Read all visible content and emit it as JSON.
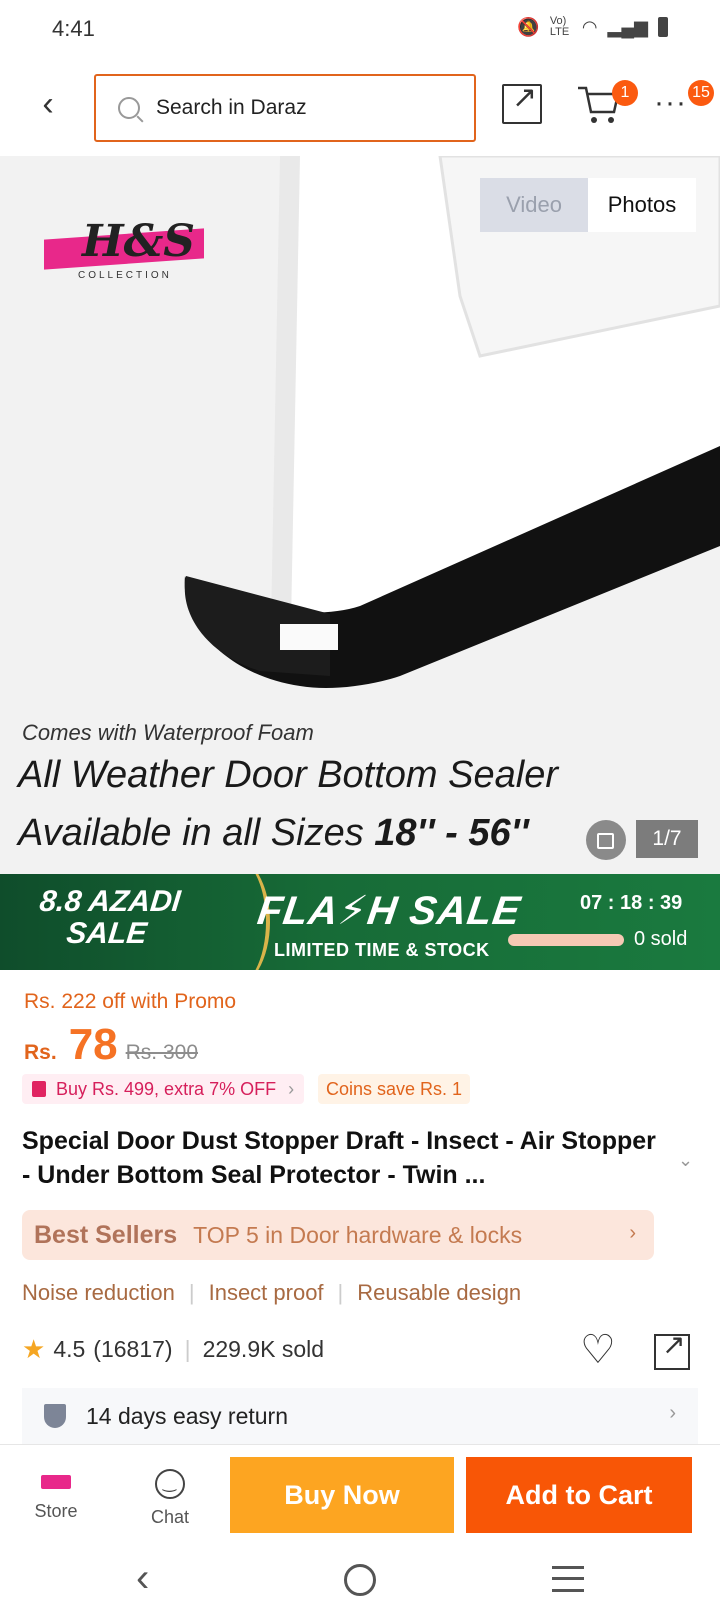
{
  "status": {
    "time": "4:41",
    "icons": [
      "mute-icon",
      "volte-icon",
      "wifi-icon",
      "signal-icon",
      "battery-icon"
    ],
    "volte_label": "Vo) LTE"
  },
  "header": {
    "search_placeholder": "Search in Daraz",
    "cart_count": "1",
    "more_count": "15"
  },
  "hero": {
    "tab_video": "Video",
    "tab_photos": "Photos",
    "brand": "H&S",
    "brand_sub": "COLLECTION",
    "caption_small": "Comes with Waterproof Foam",
    "caption_main": "All Weather Door Bottom Sealer",
    "caption_sizes": "Available in all Sizes ",
    "caption_sizes_bold": "18'' - 56''",
    "counter": "1/7"
  },
  "flash": {
    "azadi_line1": "8.8 AZADI",
    "azadi_line2": "SALE",
    "title": "FLA⚡H SALE",
    "subtitle": "LIMITED TIME & STOCK",
    "countdown": "07 : 18 : 39",
    "sold": "0 sold",
    "sold_progress": 0
  },
  "price": {
    "promo_off": "Rs. 222 off with Promo",
    "currency": "Rs.",
    "value": "78",
    "old": "Rs. 300",
    "voucher": "Buy Rs. 499, extra 7% OFF",
    "coins": "Coins save Rs. 1"
  },
  "product": {
    "title": "Special Door Dust Stopper Draft - Insect - Air Stopper - Under Bottom Seal Protector - Twin ...",
    "bestseller_label": "Best Sellers",
    "bestseller_text": "TOP 5 in Door hardware & locks",
    "features": [
      "Noise reduction",
      "Insect proof",
      "Reusable design"
    ],
    "rating": "4.5",
    "reviews": "(16817)",
    "sold": "229.9K sold",
    "return": "14 days easy return"
  },
  "actions": {
    "store": "Store",
    "chat": "Chat",
    "buy": "Buy Now",
    "add_cart": "Add to Cart"
  },
  "colors": {
    "accent": "#f85606",
    "buy": "#fda521",
    "price": "#f57224"
  }
}
